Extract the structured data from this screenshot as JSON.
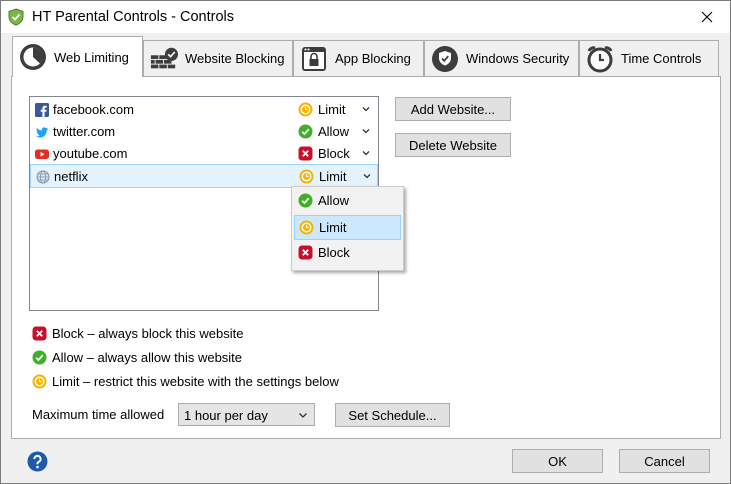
{
  "window": {
    "title": "HT Parental Controls - Controls"
  },
  "tabs": [
    {
      "label": "Web Limiting",
      "icon": "clock-pie-icon",
      "active": true
    },
    {
      "label": "Website Blocking",
      "icon": "brick-wall-check-icon",
      "active": false
    },
    {
      "label": "App Blocking",
      "icon": "window-lock-icon",
      "active": false
    },
    {
      "label": "Windows Security",
      "icon": "shield-check-icon",
      "active": false
    },
    {
      "label": "Time Controls",
      "icon": "alarm-clock-icon",
      "active": false
    }
  ],
  "websites": [
    {
      "name": "facebook.com",
      "icon": "facebook-icon",
      "status": "Limit",
      "status_icon": "limit-icon"
    },
    {
      "name": "twitter.com",
      "icon": "twitter-icon",
      "status": "Allow",
      "status_icon": "allow-icon"
    },
    {
      "name": "youtube.com",
      "icon": "youtube-icon",
      "status": "Block",
      "status_icon": "block-icon"
    },
    {
      "name": "netflix",
      "icon": "globe-icon",
      "status": "Limit",
      "status_icon": "limit-icon",
      "selected": true
    }
  ],
  "status_dropdown": {
    "options": [
      "Allow",
      "Limit",
      "Block"
    ],
    "highlighted": "Limit"
  },
  "buttons": {
    "add_website": "Add Website...",
    "delete_website": "Delete Website",
    "set_schedule": "Set Schedule...",
    "ok": "OK",
    "cancel": "Cancel"
  },
  "legend": {
    "block": "Block – always block this website",
    "allow": "Allow – always allow this website",
    "limit": "Limit – restrict this website with the settings below"
  },
  "max_time": {
    "label": "Maximum time allowed",
    "value": "1 hour per day"
  },
  "colors": {
    "allow": "#3fae29",
    "block": "#c8102e",
    "limit": "#f4b400",
    "facebook": "#3b5998",
    "twitter": "#1da1f2",
    "youtube": "#e52d27",
    "help": "#1e5aa8"
  }
}
